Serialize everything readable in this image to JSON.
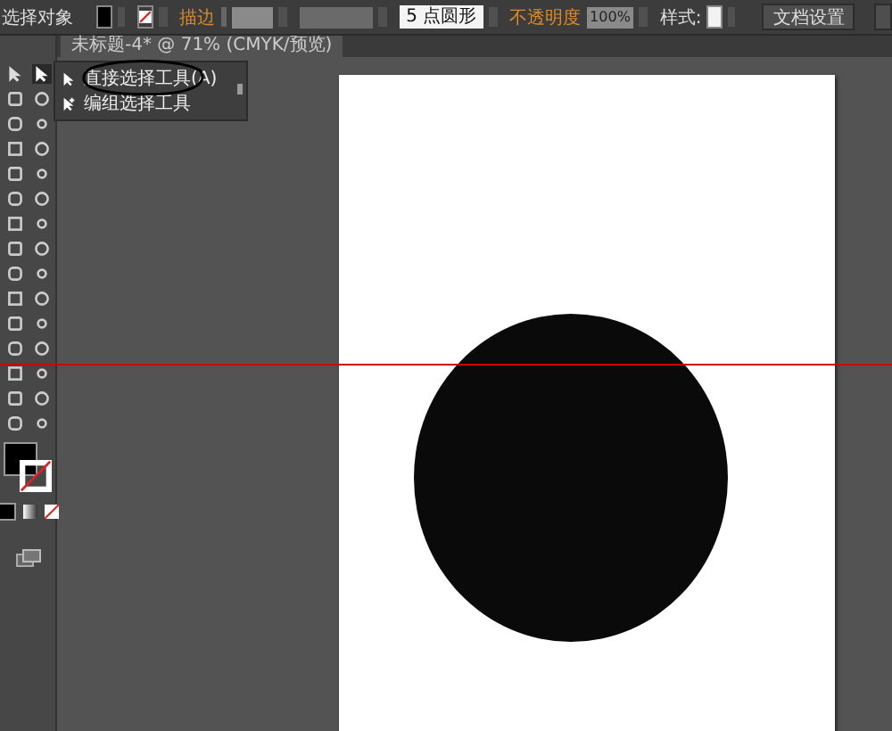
{
  "control_bar": {
    "selection_status": "选择对象",
    "stroke_label": "描边",
    "brush": "5 点圆形",
    "opacity_label": "不透明度",
    "opacity": "100%",
    "style_label": "样式:",
    "doc_settings_button": "文档设置"
  },
  "document_tab": {
    "title": "未标题-4* @ 71% (CMYK/预览)"
  },
  "flyout_menu": {
    "items": [
      {
        "label": "直接选择工具",
        "shortcut": "(A)"
      },
      {
        "label": "编组选择工具"
      }
    ]
  }
}
